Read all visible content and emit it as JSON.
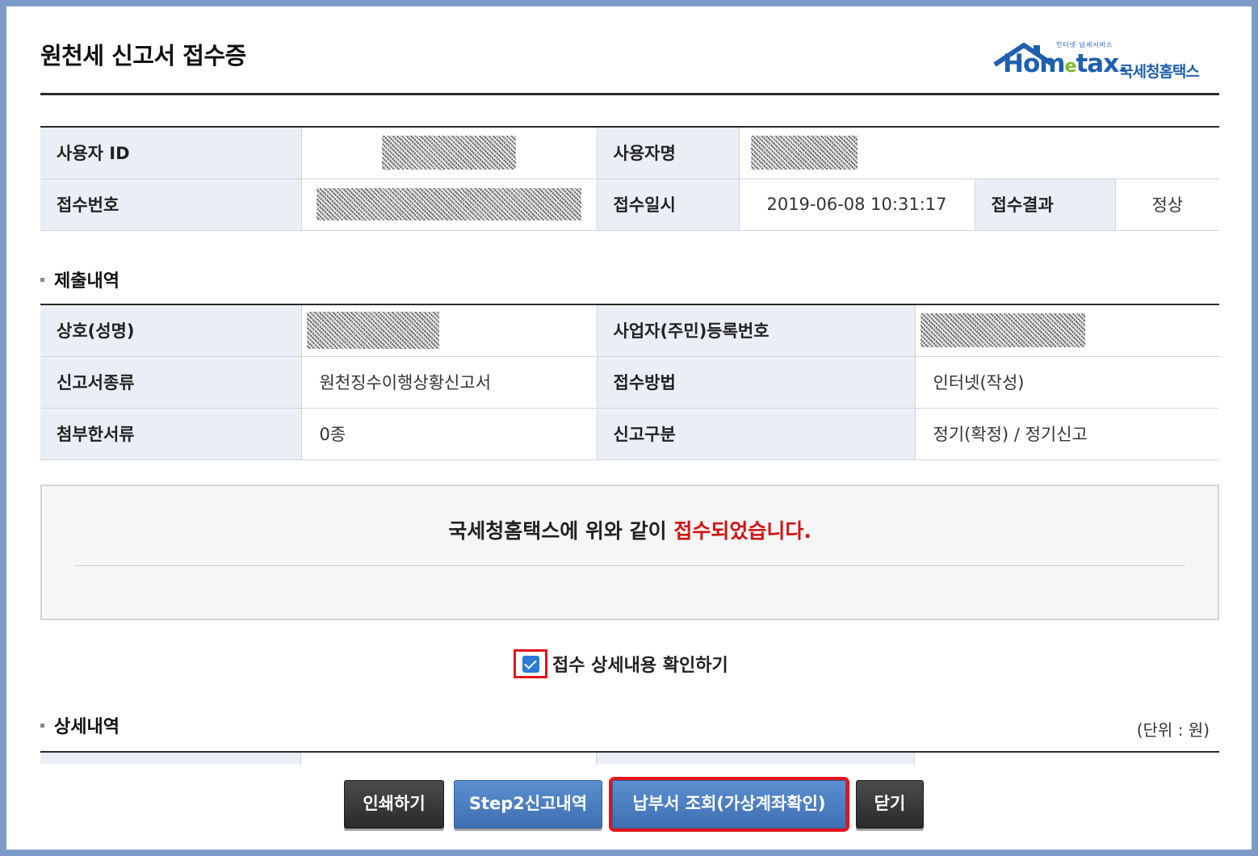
{
  "header": {
    "title": "원천세 신고서 접수증",
    "logo": {
      "tagline": "인터넷 납세서비스",
      "wordmark_prefix": "Hom",
      "wordmark_e": "e",
      "wordmark_suffix": "tax.",
      "korean": "국세청홈택스",
      "icon": "house-roof-icon",
      "brand_color": "#1f5fb0",
      "accent_color": "#7dbb2d"
    }
  },
  "receipt": {
    "user_id_label": "사용자 ID",
    "user_name_label": "사용자명",
    "receipt_no_label": "접수번호",
    "receipt_time_label": "접수일시",
    "receipt_time": "2019-06-08 10:31:17",
    "result_label": "접수결과",
    "result": "정상"
  },
  "submission": {
    "title": "제출내역",
    "company_label": "상호(성명)",
    "reg_no_label": "사업자(주민)등록번호",
    "form_type_label": "신고서종류",
    "form_type": "원천징수이행상황신고서",
    "method_label": "접수방법",
    "method": "인터넷(작성)",
    "attachments_label": "첨부한서류",
    "attachments": "0종",
    "category_label": "신고구분",
    "category": "정기(확정) / 정기신고"
  },
  "notice": {
    "prefix": "국세청홈택스에 위와 같이 ",
    "highlight": "접수되었습니다.",
    "highlight_color": "#d21414"
  },
  "confirm": {
    "label": "접수 상세내용 확인하기",
    "checked": true
  },
  "detail": {
    "title": "상세내역",
    "unit": "(단위 : 원)"
  },
  "buttons": {
    "print": "인쇄하기",
    "step2": "Step2신고내역",
    "payment": "납부서 조회(가상계좌확인)",
    "close": "닫기"
  },
  "colors": {
    "background": "#7b9bc6",
    "table_header": "#eaeef5",
    "highlight_border": "#e3131b",
    "button_dark": "#333333",
    "button_blue": "#4a7cc0"
  }
}
